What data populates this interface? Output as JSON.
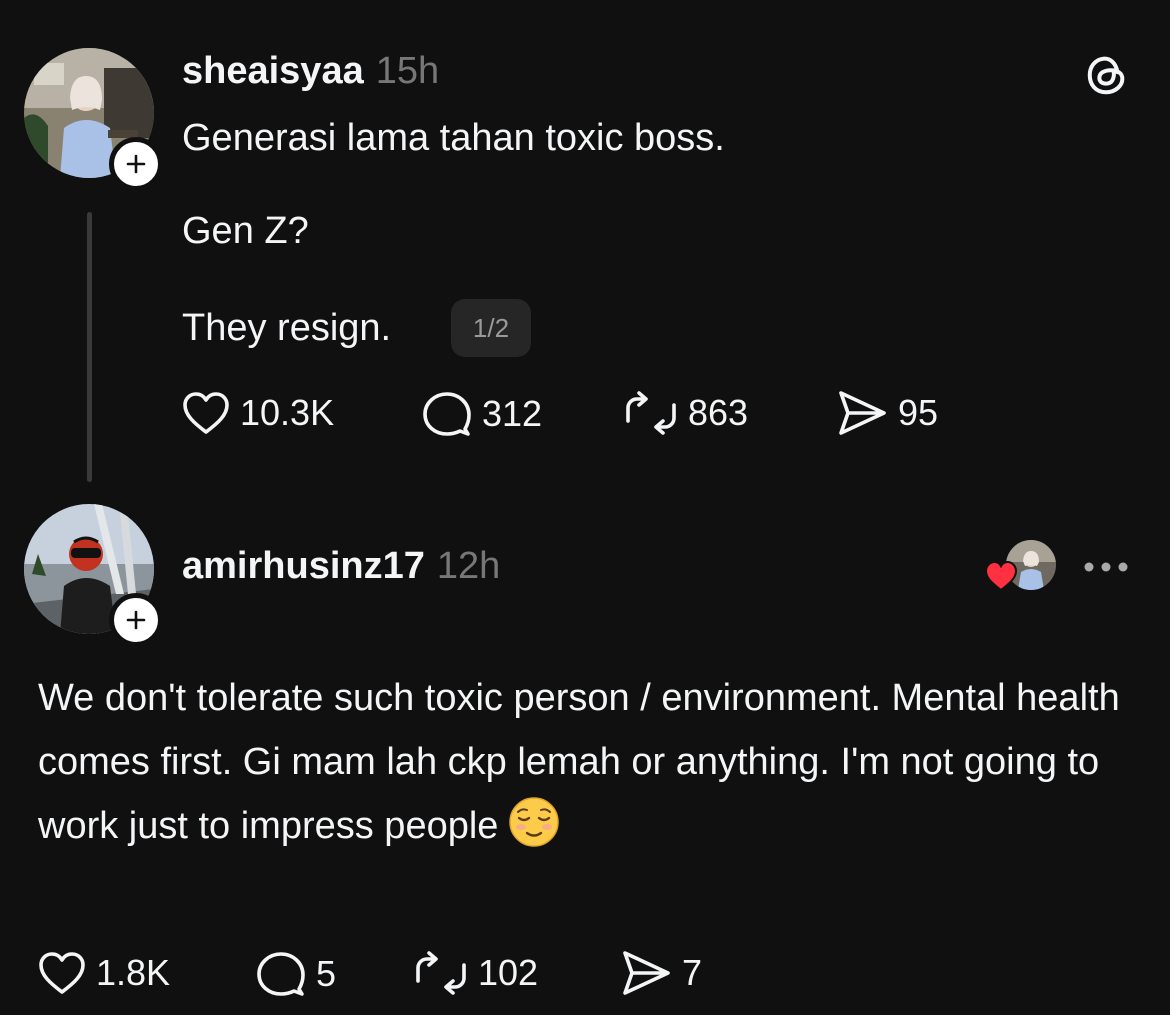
{
  "original_post": {
    "username": "sheaisyaa",
    "time": "15h",
    "text_line_1": "Generasi lama tahan toxic boss.",
    "text_line_2": "Gen Z?",
    "text_line_3": "They resign.",
    "page_indicator": "1/2",
    "likes": "10.3K",
    "replies": "312",
    "reposts": "863",
    "shares": "95",
    "icons": [
      "threads-logo-icon",
      "plus-icon",
      "heart-icon",
      "comment-icon",
      "repost-icon",
      "share-icon"
    ]
  },
  "reply_post": {
    "username": "amirhusinz17",
    "time": "12h",
    "text": "We don't tolerate such toxic person / environment. Mental health comes first. Gi mam lah ckp lemah or anything. I'm not going to work just to impress people",
    "emoji": "relieved-face-emoji",
    "likes": "1.8K",
    "replies": "5",
    "reposts": "102",
    "shares": "7",
    "icons": [
      "liked-by-author-heart-icon",
      "more-icon",
      "plus-icon",
      "heart-icon",
      "comment-icon",
      "repost-icon",
      "share-icon"
    ]
  },
  "colors": {
    "background": "#101010",
    "text_primary": "#f3f5f7",
    "text_secondary": "#777777",
    "thread_line": "#3a3a3a",
    "badge_bg": "#262626",
    "heart_red": "#ff3040"
  }
}
